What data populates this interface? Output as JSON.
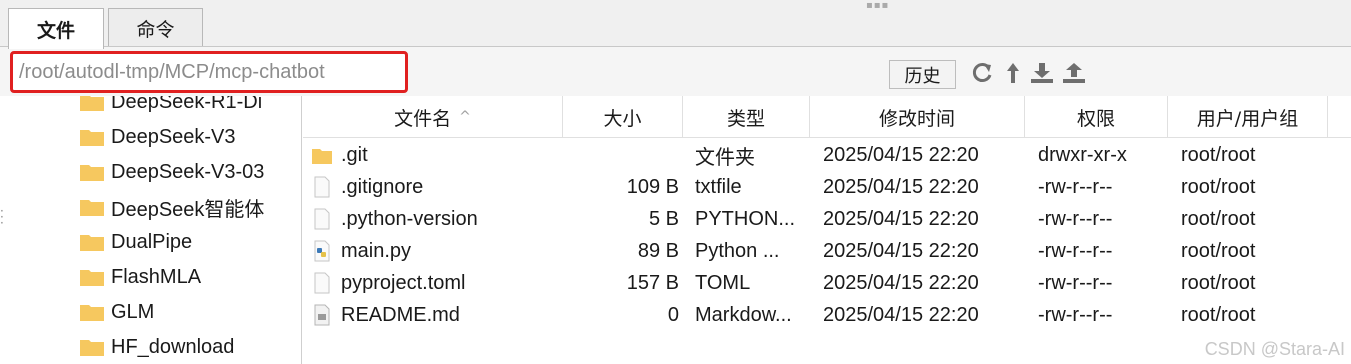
{
  "tabs": [
    {
      "label": "文件"
    },
    {
      "label": "命令"
    }
  ],
  "toolbar": {
    "path_value": "/root/autodl-tmp/MCP/mcp-chatbot",
    "history_label": "历史",
    "icons": [
      "refresh-icon",
      "up-arrow-icon",
      "download-icon",
      "upload-icon"
    ]
  },
  "tree": {
    "items": [
      {
        "label": "DeepSeek-R1-Di"
      },
      {
        "label": "DeepSeek-V3"
      },
      {
        "label": "DeepSeek-V3-03"
      },
      {
        "label": "DeepSeek智能体"
      },
      {
        "label": "DualPipe"
      },
      {
        "label": "FlashMLA"
      },
      {
        "label": "GLM"
      },
      {
        "label": "HF_download"
      }
    ]
  },
  "file_list": {
    "columns": [
      "文件名",
      "大小",
      "类型",
      "修改时间",
      "权限",
      "用户/用户组"
    ],
    "sort_indicator": "^",
    "rows": [
      {
        "name": ".git",
        "size": "",
        "type": "文件夹",
        "modified": "2025/04/15 22:20",
        "perms": "drwxr-xr-x",
        "owner": "root/root",
        "icon": "folder-icon"
      },
      {
        "name": ".gitignore",
        "size": "109 B",
        "type": "txtfile",
        "modified": "2025/04/15 22:20",
        "perms": "-rw-r--r--",
        "owner": "root/root",
        "icon": "file-icon"
      },
      {
        "name": ".python-version",
        "size": "5 B",
        "type": "PYTHON...",
        "modified": "2025/04/15 22:20",
        "perms": "-rw-r--r--",
        "owner": "root/root",
        "icon": "file-icon"
      },
      {
        "name": "main.py",
        "size": "89 B",
        "type": "Python ...",
        "modified": "2025/04/15 22:20",
        "perms": "-rw-r--r--",
        "owner": "root/root",
        "icon": "python-file-icon"
      },
      {
        "name": "pyproject.toml",
        "size": "157 B",
        "type": "TOML",
        "modified": "2025/04/15 22:20",
        "perms": "-rw-r--r--",
        "owner": "root/root",
        "icon": "file-icon"
      },
      {
        "name": "README.md",
        "size": "0",
        "type": "Markdow...",
        "modified": "2025/04/15 22:20",
        "perms": "-rw-r--r--",
        "owner": "root/root",
        "icon": "markdown-file-icon"
      }
    ]
  },
  "watermark": "CSDN @Stara-AI",
  "colors": {
    "highlight_border": "#e02020",
    "folder": "#f6c85f"
  }
}
